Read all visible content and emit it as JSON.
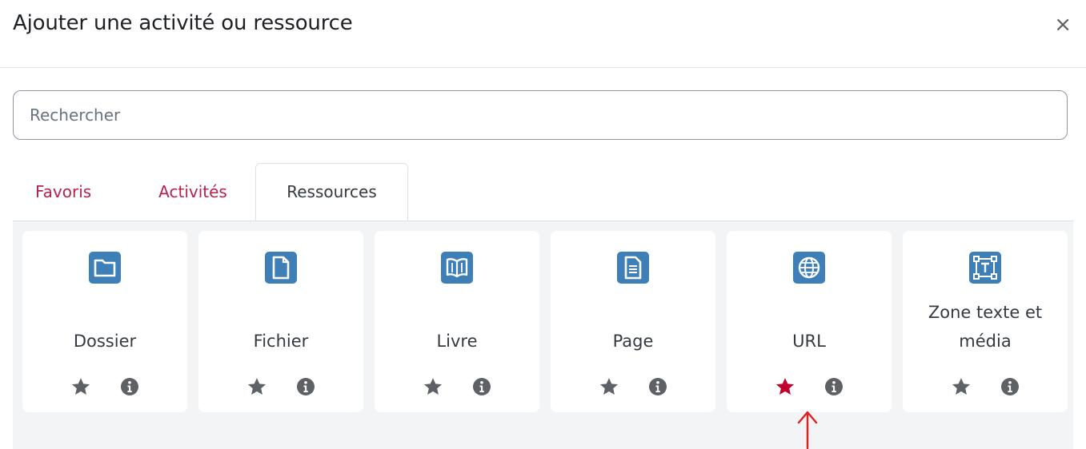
{
  "dialog": {
    "title": "Ajouter une activité ou ressource",
    "close": "×"
  },
  "search": {
    "placeholder": "Rechercher",
    "value": ""
  },
  "tabs": [
    {
      "label": "Favoris"
    },
    {
      "label": "Activités"
    },
    {
      "label": "Ressources",
      "active": true
    }
  ],
  "resources": [
    {
      "label": "Dossier",
      "icon": "folder-icon",
      "starred": false
    },
    {
      "label": "Fichier",
      "icon": "file-icon",
      "starred": false
    },
    {
      "label": "Livre",
      "icon": "book-icon",
      "starred": false
    },
    {
      "label": "Page",
      "icon": "page-icon",
      "starred": false
    },
    {
      "label": "URL",
      "icon": "globe-icon",
      "starred": true
    },
    {
      "label": "Zone texte et média",
      "icon": "text-media-icon",
      "starred": false
    }
  ],
  "colors": {
    "accent": "#b7224d",
    "icon_blue": "#3f7fb7",
    "star_default": "#5e6266",
    "star_favorite": "#c2002f",
    "annotation_arrow": "#e02020"
  }
}
